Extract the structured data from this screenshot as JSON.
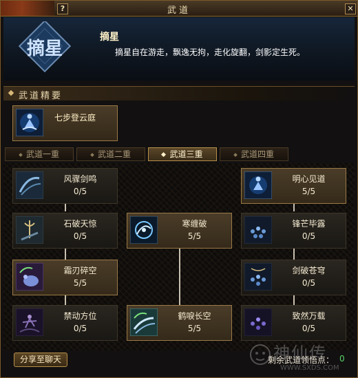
{
  "window": {
    "title": "武道"
  },
  "title_buttons": {
    "help": "?",
    "close": "✕"
  },
  "header": {
    "emblem_text": "摘星",
    "skill_name": "摘星",
    "description": "摘星自在游走，飘逸无拘，走化旋翻，剑影定生死。"
  },
  "essentials": {
    "title": "武道精要",
    "item": {
      "label": "七步登云庭",
      "icon": "meditating-figure-icon"
    }
  },
  "tabs": [
    {
      "label": "武道一重",
      "active": false
    },
    {
      "label": "武道二重",
      "active": false
    },
    {
      "label": "武道三重",
      "active": true
    },
    {
      "label": "武道四重",
      "active": false
    }
  ],
  "nodes": {
    "fengzhou": {
      "name": "风骤剑鸣",
      "points": "0/5",
      "icon": "blade-wind-icon"
    },
    "mingxin": {
      "name": "明心见道",
      "points": "5/5",
      "icon": "meditating-figure-icon"
    },
    "shipo": {
      "name": "石破天惊",
      "points": "0/5",
      "icon": "trident-sword-icon"
    },
    "hanchan": {
      "name": "寒缠破",
      "points": "5/5",
      "icon": "swirl-orb-icon"
    },
    "fengmang": {
      "name": "锋芒毕露",
      "points": "0/5",
      "icon": "orb-cluster-icon"
    },
    "shuangren": {
      "name": "霜刃碎空",
      "points": "5/5",
      "icon": "palm-strike-icon"
    },
    "jianpo": {
      "name": "剑破苍穹",
      "points": "0/5",
      "icon": "orb-cluster-icon"
    },
    "jindong": {
      "name": "禁动方位",
      "points": "0/5",
      "icon": "shadow-dancer-icon"
    },
    "helie": {
      "name": "鹤唳长空",
      "points": "5/5",
      "icon": "blade-wind-icon"
    },
    "zhiran": {
      "name": "致然万载",
      "points": "0/5",
      "icon": "orb-cluster-icon"
    }
  },
  "footer": {
    "share_label": "分享至聊天",
    "remaining_label": "剩余武道领悟点：",
    "remaining_value": "0"
  },
  "watermark": {
    "main": "神仙传",
    "url": "WWW.SXDS.COM"
  }
}
